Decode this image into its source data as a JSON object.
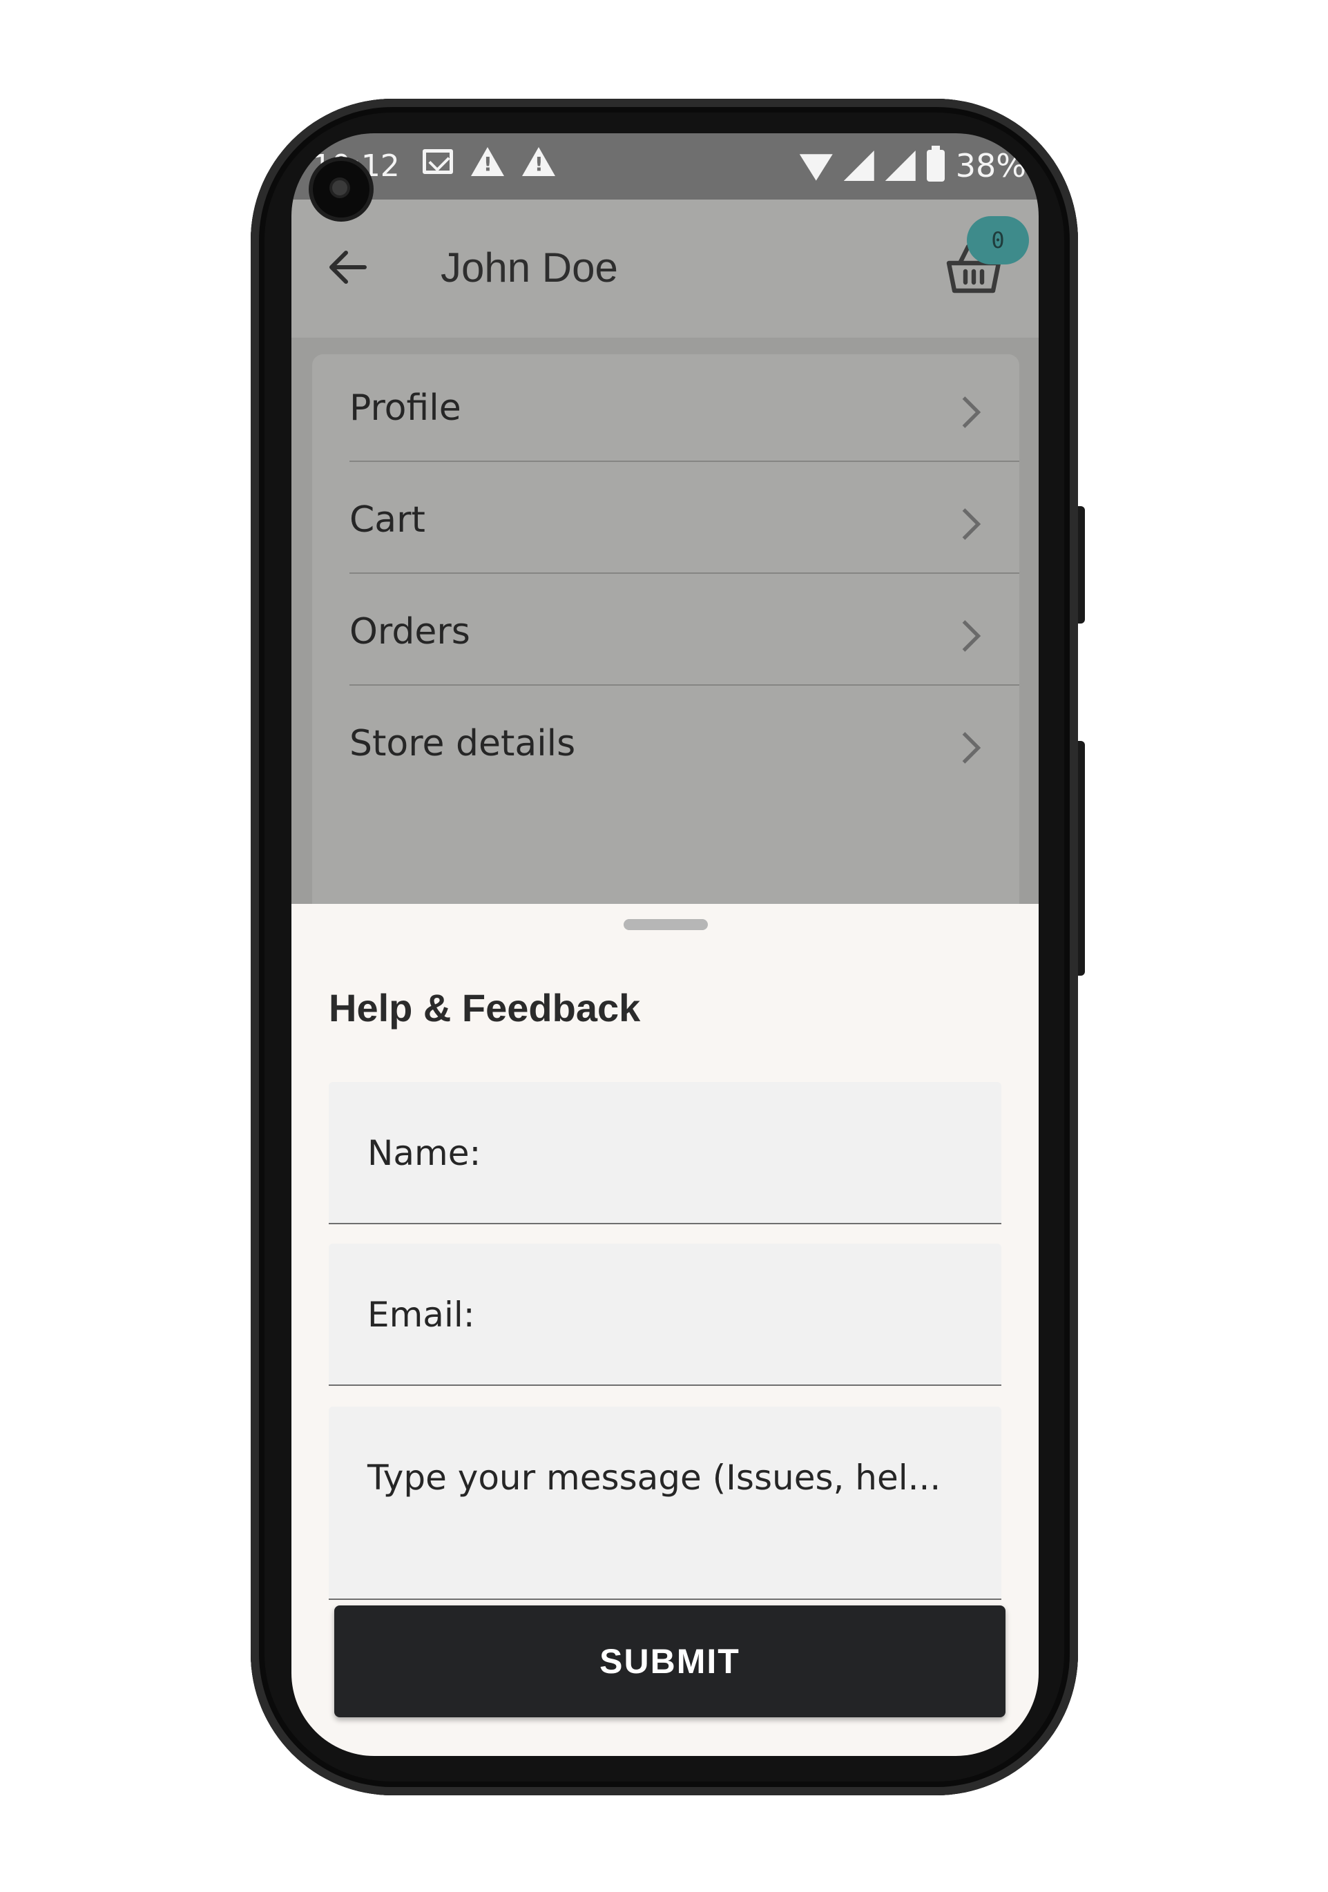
{
  "status_bar": {
    "time": "10:12",
    "battery": "38%"
  },
  "app_bar": {
    "title": "John Doe",
    "cart_count": "0"
  },
  "menu": {
    "items": [
      {
        "label": "Profile"
      },
      {
        "label": "Cart"
      },
      {
        "label": "Orders"
      },
      {
        "label": "Store details"
      }
    ]
  },
  "sheet": {
    "title": "Help & Feedback",
    "name_placeholder": "Name:",
    "email_placeholder": "Email:",
    "message_placeholder": "Type your message (Issues, hel...",
    "submit_label": "SUBMIT"
  },
  "colors": {
    "accent": "#3e8b8b",
    "button": "#232426",
    "sheet_bg": "#f9f6f3",
    "scrim": "#a8a8a6"
  },
  "icons": [
    "back-arrow-icon",
    "basket-icon",
    "chevron-right-icon",
    "mail-icon",
    "warning-icon",
    "wifi-icon",
    "signal-icon",
    "battery-icon",
    "nav-back-icon",
    "nav-home-icon",
    "nav-recents-icon"
  ]
}
